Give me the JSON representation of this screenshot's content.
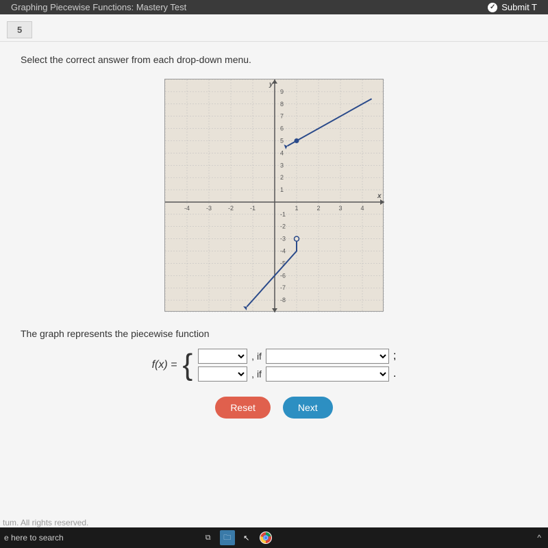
{
  "header": {
    "title": "Graphing Piecewise Functions: Mastery Test",
    "submit_label": "Submit T"
  },
  "question": {
    "number": "5",
    "instruction": "Select the correct answer from each drop-down menu.",
    "prompt": "The graph represents the piecewise function",
    "fx_label": "f(x) =",
    "if_label": ", if",
    "end_punct_1": ";",
    "end_punct_2": "."
  },
  "buttons": {
    "reset": "Reset",
    "next": "Next"
  },
  "footer": {
    "copyright": "tum. All rights reserved.",
    "search_hint": "e here to search"
  },
  "chart_data": {
    "type": "line",
    "xlabel": "x",
    "ylabel": "y",
    "xlim": [
      -5,
      5
    ],
    "ylim": [
      -9,
      10
    ],
    "x_ticks": [
      -4,
      -3,
      -2,
      -1,
      1,
      2,
      3,
      4
    ],
    "y_ticks": [
      9,
      8,
      7,
      6,
      5,
      4,
      3,
      2,
      1,
      -1,
      -2,
      -3,
      -4,
      -5,
      -6,
      -7,
      -8
    ],
    "series": [
      {
        "name": "segment1",
        "points": [
          [
            -1,
            -8
          ],
          [
            1,
            -4
          ],
          [
            1,
            -3
          ]
        ],
        "start_open": false,
        "end_open": true,
        "note": "lower line, open circle at (1,-3), arrow downward-left"
      },
      {
        "name": "segment2",
        "points": [
          [
            1,
            5
          ],
          [
            4,
            8
          ]
        ],
        "start_open": false,
        "end_open": false,
        "note": "upper line, closed dot at (1,5), arrow upward-right"
      }
    ]
  }
}
